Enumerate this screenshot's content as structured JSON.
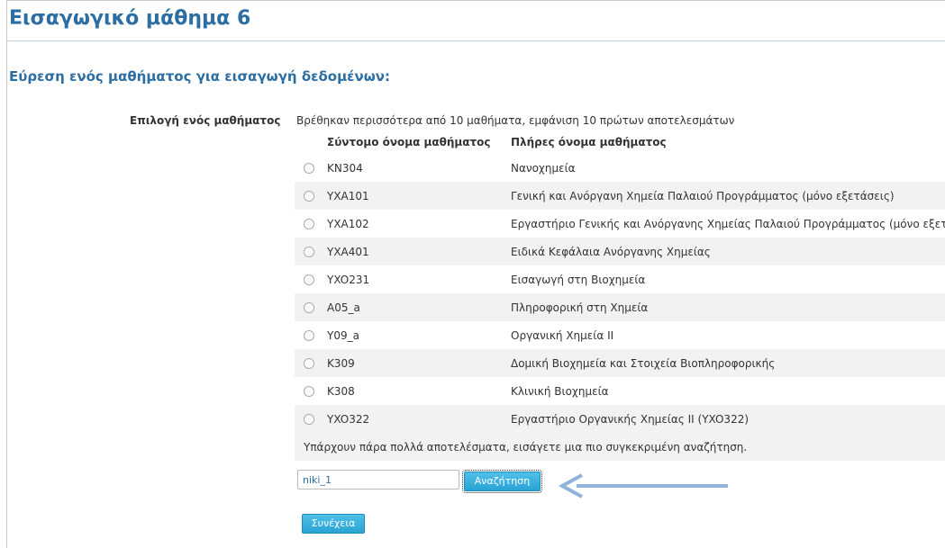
{
  "page": {
    "title": "Εισαγωγικό μάθημα 6",
    "subtitle": "Εύρεση ενός μαθήματος για εισαγωγή δεδομένων:"
  },
  "form": {
    "field_label": "Επιλογή ενός μαθήματος",
    "info": "Βρέθηκαν περισσότερα από 10 μαθήματα, εμφάνιση 10 πρώτων αποτελεσμάτων",
    "columns": {
      "short_name": "Σύντομο όνομα μαθήματος",
      "full_name": "Πλήρες όνομα μαθήματος"
    },
    "courses": [
      {
        "code": "KN304",
        "name": "Νανοχημεία"
      },
      {
        "code": "YXA101",
        "name": "Γενική και Ανόργανη Χημεία Παλαιού Προγράμματος (μόνο εξετάσεις)"
      },
      {
        "code": "YXA102",
        "name": "Εργαστήριο Γενικής και Ανόργανης Χημείας Παλαιού Προγράμματος (μόνο εξετάσεις)"
      },
      {
        "code": "YXA401",
        "name": "Ειδικά Κεφάλαια Ανόργανης Χημείας"
      },
      {
        "code": "YXO231",
        "name": "Εισαγωγή στη Βιοχημεία"
      },
      {
        "code": "A05_a",
        "name": "Πληροφορική στη Χημεία"
      },
      {
        "code": "Y09_a",
        "name": "Οργανική Χημεία II"
      },
      {
        "code": "K309",
        "name": "Δομική Βιοχημεία και Στοιχεία Βιοπληροφορικής"
      },
      {
        "code": "K308",
        "name": "Κλινική Βιοχημεία"
      },
      {
        "code": "YXO322",
        "name": "Εργαστήριο Οργανικής Χημείας II (YXO322)"
      }
    ],
    "too_many": "Υπάρχουν πάρα πολλά αποτελέσματα, εισάγετε μια πιο συγκεκριμένη αναζήτηση.",
    "search_value": "niki_1",
    "search_button": "Αναζήτηση",
    "continue_button": "Συνέχεια"
  },
  "colors": {
    "heading": "#2d6ea2",
    "button": "#2aa3d3",
    "arrow": "#8fb3d9"
  }
}
